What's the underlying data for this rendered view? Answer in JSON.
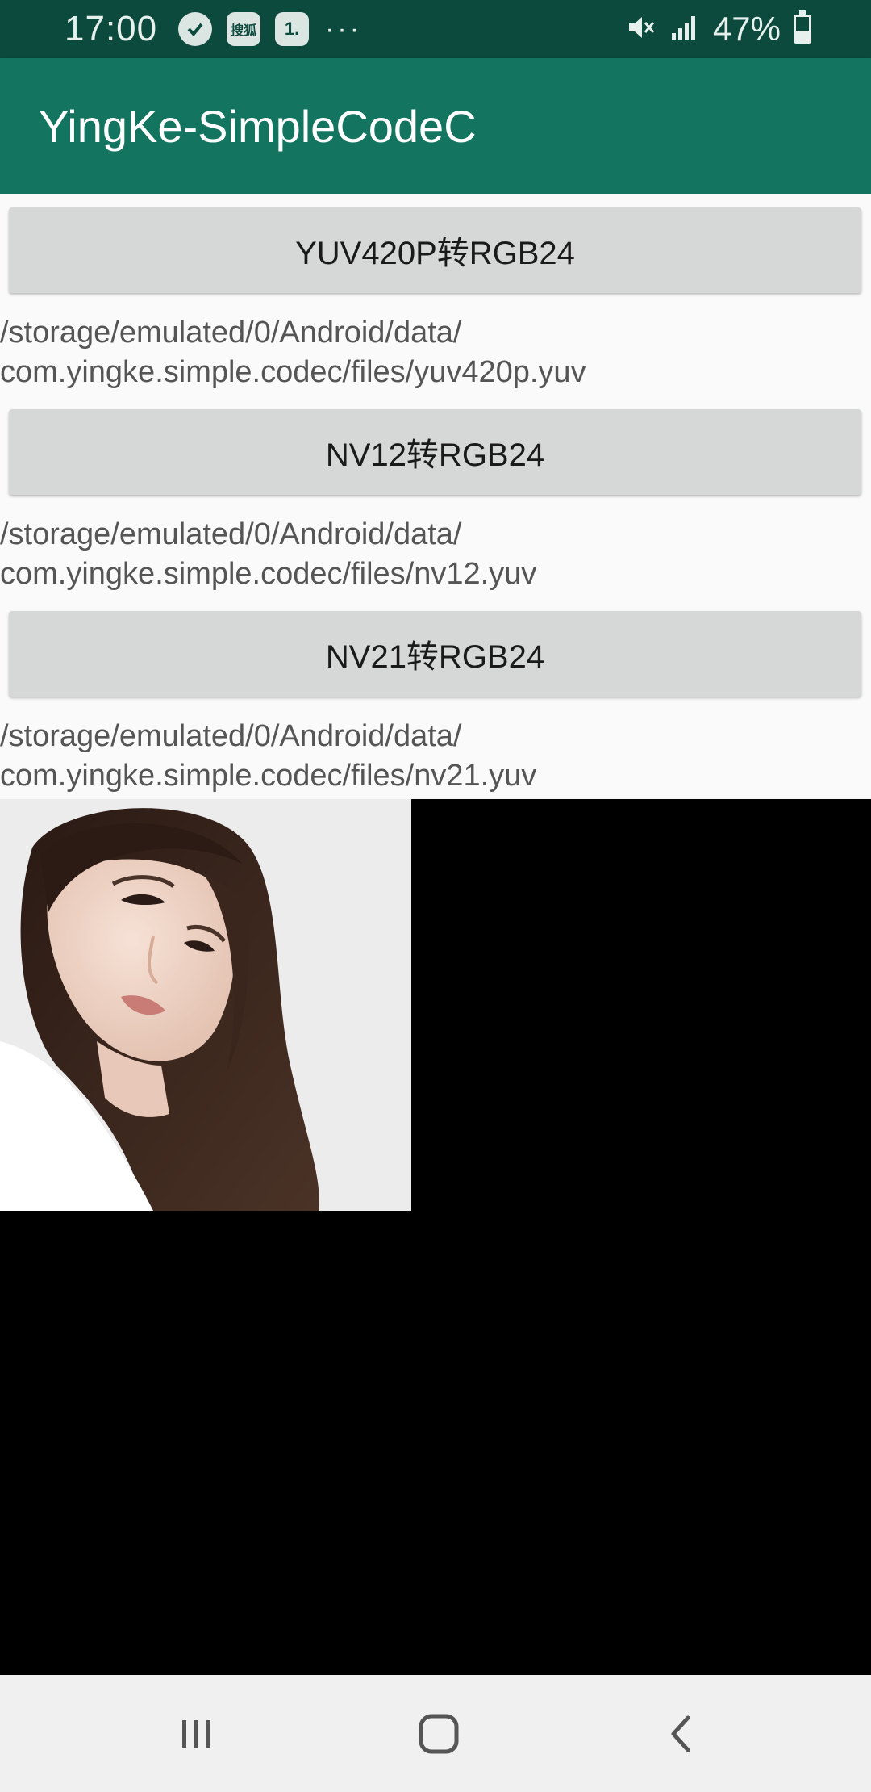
{
  "status_bar": {
    "time": "17:00",
    "notification_icons": [
      "check-icon",
      "sohu-icon",
      "one-icon"
    ],
    "notif_sohu_label": "搜狐",
    "notif_one_label": "1.",
    "more": "···",
    "battery": "47%"
  },
  "app_bar": {
    "title": "YingKe-SimpleCodeC"
  },
  "actions": [
    {
      "label": "YUV420P转RGB24",
      "path": "/storage/emulated/0/Android/data/\ncom.yingke.simple.codec/files/yuv420p.yuv"
    },
    {
      "label": "NV12转RGB24",
      "path": "/storage/emulated/0/Android/data/\ncom.yingke.simple.codec/files/nv12.yuv"
    },
    {
      "label": "NV21转RGB24",
      "path": "/storage/emulated/0/Android/data/\ncom.yingke.simple.codec/files/nv21.yuv"
    }
  ],
  "colors": {
    "status_bar": "#0b4a3c",
    "app_bar": "#13755f",
    "content_bg": "#fafafa",
    "button_bg": "#d6d7d7",
    "image_bg": "#000000",
    "nav_bar": "#f0f0f0"
  },
  "nav_bar": {
    "icons": [
      "recent-apps-icon",
      "home-icon",
      "back-icon"
    ]
  }
}
